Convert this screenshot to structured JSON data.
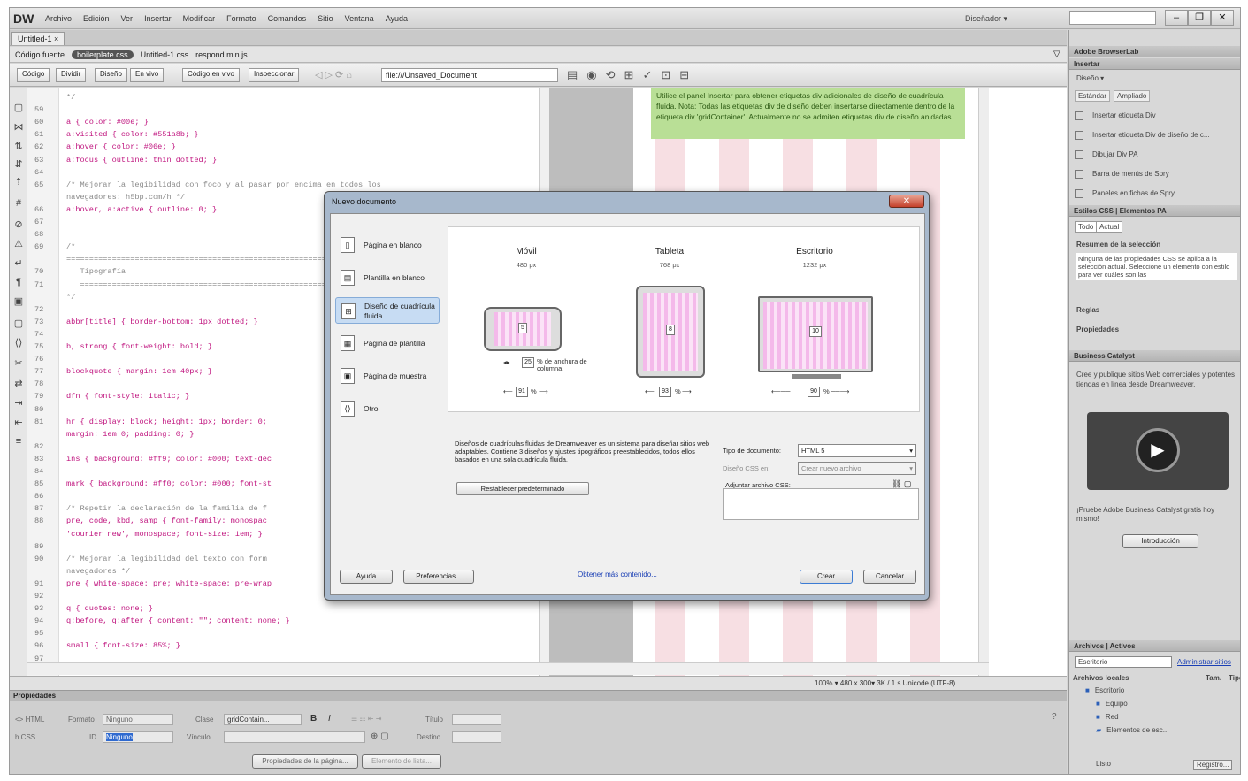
{
  "app": {
    "logo": "DW",
    "menus": [
      "Archivo",
      "Edición",
      "Ver",
      "Insertar",
      "Modificar",
      "Formato",
      "Comandos",
      "Sitio",
      "Ventana",
      "Ayuda"
    ],
    "workspace": "Diseñador ▾"
  },
  "document": {
    "tab": "Untitled-1 ×",
    "related_files": [
      "Código fuente",
      "boilerplate.css",
      "Untitled-1.css",
      "respond.min.js"
    ],
    "view_buttons": [
      "Código",
      "Dividir",
      "Diseño",
      "En vivo",
      "Código en vivo",
      "Inspeccionar"
    ],
    "title_value": "file:///Unsaved_Document"
  },
  "code_lines": [
    {
      "n": "",
      "t": "*/"
    },
    {
      "n": "59",
      "t": ""
    },
    {
      "n": "60",
      "t": "a { color: #00e; }"
    },
    {
      "n": "61",
      "t": "a:visited { color: #551a8b; }"
    },
    {
      "n": "62",
      "t": "a:hover { color: #06e; }"
    },
    {
      "n": "63",
      "t": "a:focus { outline: thin dotted; }"
    },
    {
      "n": "64",
      "t": ""
    },
    {
      "n": "65",
      "t": "/* Mejorar la legibilidad con foco y al pasar por encima en todos los"
    },
    {
      "n": "",
      "t": "navegadores: h5bp.com/h */"
    },
    {
      "n": "66",
      "t": "a:hover, a:active { outline: 0; }"
    },
    {
      "n": "67",
      "t": ""
    },
    {
      "n": "68",
      "t": ""
    },
    {
      "n": "69",
      "t": "/*"
    },
    {
      "n": "",
      "t": "======================================================================"
    },
    {
      "n": "70",
      "t": "   Tipografía"
    },
    {
      "n": "71",
      "t": "   =================================================================="
    },
    {
      "n": "",
      "t": "*/"
    },
    {
      "n": "72",
      "t": ""
    },
    {
      "n": "73",
      "t": "abbr[title] { border-bottom: 1px dotted; }"
    },
    {
      "n": "74",
      "t": ""
    },
    {
      "n": "75",
      "t": "b, strong { font-weight: bold; }"
    },
    {
      "n": "76",
      "t": ""
    },
    {
      "n": "77",
      "t": "blockquote { margin: 1em 40px; }"
    },
    {
      "n": "78",
      "t": ""
    },
    {
      "n": "79",
      "t": "dfn { font-style: italic; }"
    },
    {
      "n": "80",
      "t": ""
    },
    {
      "n": "81",
      "t": "hr { display: block; height: 1px; border: 0;"
    },
    {
      "n": "",
      "t": "margin: 1em 0; padding: 0; }"
    },
    {
      "n": "82",
      "t": ""
    },
    {
      "n": "83",
      "t": "ins { background: #ff9; color: #000; text-dec"
    },
    {
      "n": "84",
      "t": ""
    },
    {
      "n": "85",
      "t": "mark { background: #ff0; color: #000; font-st"
    },
    {
      "n": "86",
      "t": ""
    },
    {
      "n": "87",
      "t": "/* Repetir la declaración de la familia de f"
    },
    {
      "n": "88",
      "t": "pre, code, kbd, samp { font-family: monospac"
    },
    {
      "n": "",
      "t": "'courier new', monospace; font-size: 1em; }"
    },
    {
      "n": "89",
      "t": ""
    },
    {
      "n": "90",
      "t": "/* Mejorar la legibilidad del texto con form"
    },
    {
      "n": "",
      "t": "navegadores */"
    },
    {
      "n": "91",
      "t": "pre { white-space: pre; white-space: pre-wrap"
    },
    {
      "n": "92",
      "t": ""
    },
    {
      "n": "93",
      "t": "q { quotes: none; }"
    },
    {
      "n": "94",
      "t": "q:before, q:after { content: \"\"; content: none; }"
    },
    {
      "n": "95",
      "t": ""
    },
    {
      "n": "96",
      "t": "small { font-size: 85%; }"
    },
    {
      "n": "97",
      "t": ""
    }
  ],
  "design": {
    "note": "Utilice el panel Insertar para obtener etiquetas div adicionales de diseño de cuadrícula fluida. Nota: Todas las etiquetas div de diseño deben insertarse directamente dentro de la etiqueta div 'gridContainer'. Actualmente no se admiten etiquetas div de diseño anidadas."
  },
  "status": {
    "info": "100% ▾   480 x 300▾   3K / 1 s  Unicode (UTF-8)"
  },
  "properties": {
    "header": "Propiedades",
    "html": "<> HTML",
    "css": "h CSS",
    "format_label": "Formato",
    "format_value": "Ninguno",
    "class_label": "Clase",
    "class_value": "gridContain...",
    "id_label": "ID",
    "id_value": "Ninguno",
    "link_label": "Vínculo",
    "title_label": "Título",
    "target_label": "Destino",
    "page_props": "Propiedades de la página...",
    "list_item": "Elemento de lista..."
  },
  "right_panel": {
    "browserlab": "Adobe BrowserLab",
    "insert": "Insertar",
    "insert_category": "Diseño ▾",
    "insert_tabs": [
      "Estándar",
      "Ampliado"
    ],
    "insert_items": [
      "Insertar etiqueta Div",
      "Insertar etiqueta Div de diseño de c...",
      "Dibujar Div PA",
      "Barra de menús de Spry",
      "Paneles en fichas de Spry"
    ],
    "css_tabs": [
      "Estilos CSS",
      "Elementos PA"
    ],
    "css_subtabs": [
      "Todo",
      "Actual"
    ],
    "summary_title": "Resumen de la selección",
    "summary_text": "Ninguna de las propiedades CSS se aplica a la selección actual. Seleccione un elemento con estilo para ver cuáles son las",
    "rules": "Reglas",
    "properties": "Propiedades",
    "bc_header": "Business Catalyst",
    "bc_text": "Cree y publique sitios Web comerciales y potentes tiendas en línea desde Dreamweaver.",
    "bc_promo": "¡Pruebe Adobe Business Catalyst gratis hoy mismo!",
    "bc_button": "Introducción",
    "files_tabs": [
      "Archivos",
      "Activos"
    ],
    "files_site": "Escritorio",
    "files_manage": "Administrar sitios",
    "files_col1": "Archivos locales",
    "files_col2": "Tam.",
    "files_col3": "Tipo",
    "tree": [
      "Escritorio",
      "Equipo",
      "Red",
      "Elementos de esc..."
    ],
    "footer_left": "Listo",
    "footer_right": "Registro..."
  },
  "dialog": {
    "title": "Nuevo documento",
    "categories": [
      "Página en blanco",
      "Plantilla en blanco",
      "Diseño de cuadrícula fluida",
      "Página de plantilla",
      "Página de muestra",
      "Otro"
    ],
    "devices": [
      {
        "name": "Móvil",
        "width": "480 px",
        "cols": "5",
        "margin": "25",
        "gutter": "91"
      },
      {
        "name": "Tableta",
        "width": "768 px",
        "cols": "8",
        "gutter": "93"
      },
      {
        "name": "Escritorio",
        "width": "1232 px",
        "cols": "10",
        "gutter": "90"
      }
    ],
    "column_width_label": "% de anchura de columna",
    "pct": "%",
    "description": "Diseños de cuadrículas fluidas de Dreamweaver es un sistema para diseñar sitios web adaptables. Contiene 3 diseños y ajustes tipográficos preestablecidos, todos ellos basados en una sola cuadrícula fluida.",
    "reset": "Restablecer predeterminado",
    "doctype_label": "Tipo de documento:",
    "doctype_value": "HTML 5",
    "css_layout_label": "Diseño CSS en:",
    "css_layout_value": "Crear nuevo archivo",
    "attach_css_label": "Adjuntar archivo CSS:",
    "help": "Ayuda",
    "prefs": "Preferencias...",
    "more": "Obtener más contenido...",
    "create": "Crear",
    "cancel": "Cancelar",
    "close": "✕"
  }
}
